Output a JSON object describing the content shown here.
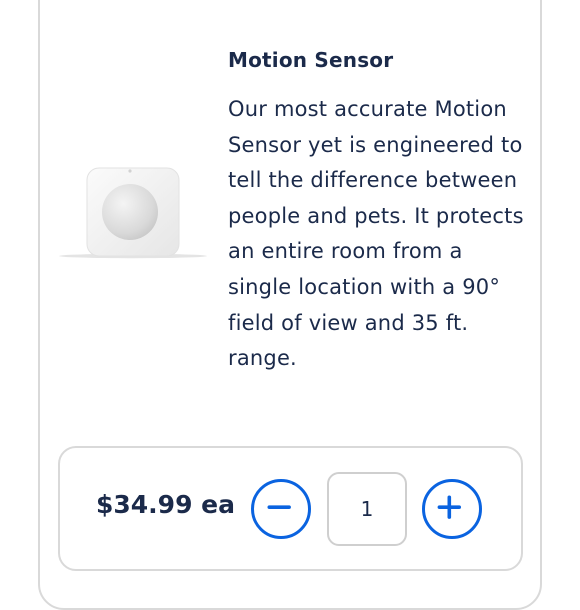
{
  "product": {
    "title": "Motion Sensor",
    "description": "Our most accurate Motion Sensor yet is engineered to tell the difference between people and pets. It protects an entire room from a single location with a 90° field of view and 35 ft. range.",
    "image_icon": "motion-sensor-device"
  },
  "purchase": {
    "price": "$34.99 ea",
    "quantity": "1",
    "decrement_icon": "minus-icon",
    "increment_icon": "plus-icon"
  },
  "colors": {
    "accent": "#0a63e0",
    "text": "#1b2a4a",
    "border": "#d9d9d9"
  }
}
